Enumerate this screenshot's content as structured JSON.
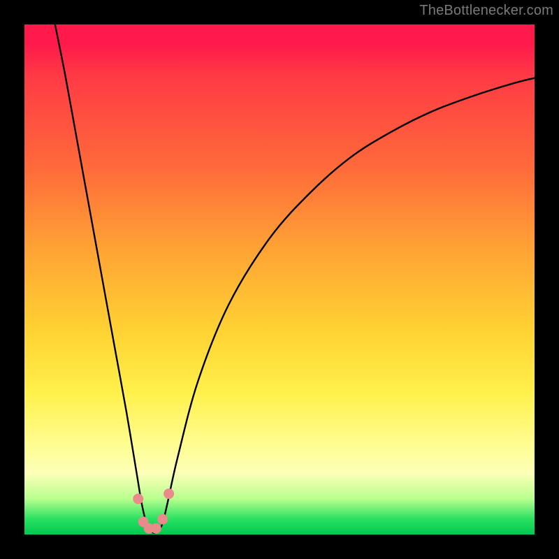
{
  "attribution": "TheBottlenecker.com",
  "chart_data": {
    "type": "line",
    "title": "",
    "xlabel": "",
    "ylabel": "",
    "xlim": [
      0,
      100
    ],
    "ylim": [
      0,
      100
    ],
    "series": [
      {
        "name": "bottleneck-curve",
        "x": [
          6,
          8,
          10,
          12,
          14,
          16,
          18,
          20,
          22,
          23,
          24,
          25,
          26,
          27,
          28,
          30,
          34,
          40,
          48,
          56,
          64,
          72,
          80,
          88,
          96,
          100
        ],
        "y": [
          100,
          90,
          79,
          68,
          57,
          46,
          35,
          24,
          12,
          6,
          2,
          0.5,
          0.5,
          2,
          6,
          15,
          30,
          45,
          58,
          67,
          74,
          79,
          83,
          86,
          88.5,
          89.5
        ]
      }
    ],
    "markers": {
      "name": "highlight-dots",
      "color": "#e98b8b",
      "points": [
        {
          "x": 22.3,
          "y": 7.0
        },
        {
          "x": 23.3,
          "y": 2.5
        },
        {
          "x": 24.4,
          "y": 1.2
        },
        {
          "x": 25.8,
          "y": 1.2
        },
        {
          "x": 27.1,
          "y": 3.0
        },
        {
          "x": 28.3,
          "y": 8.0
        }
      ]
    },
    "background_gradient": {
      "top": "#ff1a4b",
      "mid1": "#ffa634",
      "mid2": "#fff04a",
      "bottom": "#00c850"
    }
  }
}
